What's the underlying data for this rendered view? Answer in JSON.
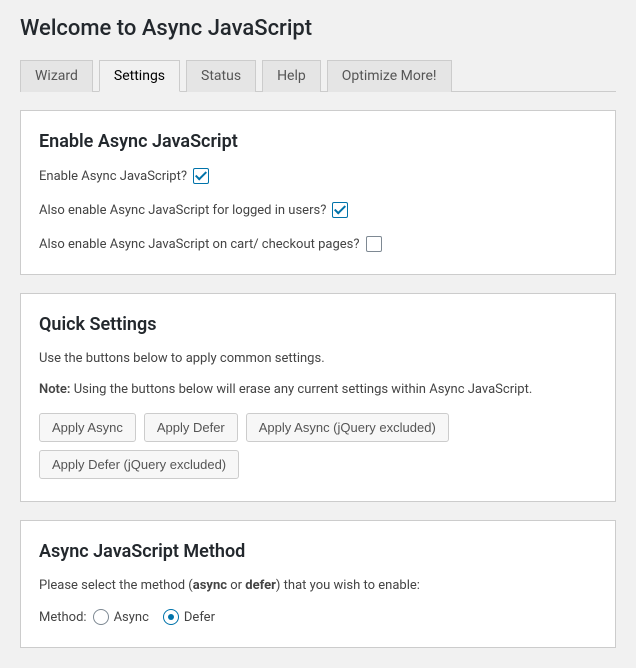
{
  "page_title": "Welcome to Async JavaScript",
  "tabs": {
    "wizard": "Wizard",
    "settings": "Settings",
    "status": "Status",
    "help": "Help",
    "optimize": "Optimize More!"
  },
  "active_tab": "settings",
  "enable": {
    "heading": "Enable Async JavaScript",
    "enable_label": "Enable Async JavaScript?",
    "enable_checked": true,
    "loggedin_label": "Also enable Async JavaScript for logged in users?",
    "loggedin_checked": true,
    "cart_label": "Also enable Async JavaScript on cart/ checkout pages?",
    "cart_checked": false
  },
  "quick": {
    "heading": "Quick Settings",
    "descr": "Use the buttons below to apply common settings.",
    "note_label": "Note:",
    "note_text": " Using the buttons below will erase any current settings within Async JavaScript.",
    "buttons": {
      "apply_async": "Apply Async",
      "apply_defer": "Apply Defer",
      "apply_async_nojq": "Apply Async (jQuery excluded)",
      "apply_defer_nojq": "Apply Defer (jQuery excluded)"
    }
  },
  "method": {
    "heading": "Async JavaScript Method",
    "descr_1": "Please select the method (",
    "descr_strong1": "async",
    "descr_2": " or ",
    "descr_strong2": "defer",
    "descr_3": ") that you wish to enable:",
    "method_label": "Method:",
    "radio_async": "Async",
    "radio_defer": "Defer",
    "selected": "defer"
  }
}
